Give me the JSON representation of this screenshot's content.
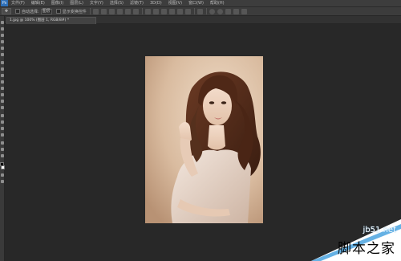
{
  "menubar": {
    "logo": "Ps",
    "items": [
      "文件(F)",
      "编辑(E)",
      "图像(I)",
      "图层(L)",
      "文字(Y)",
      "选择(S)",
      "滤镜(T)",
      "3D(D)",
      "视图(V)",
      "窗口(W)",
      "帮助(H)"
    ]
  },
  "options": {
    "auto_select_label": "自动选择:",
    "auto_select_value": "图层",
    "show_transform_label": "显示变换控件"
  },
  "document": {
    "tab_label": "1.jpg @ 100% (图层 1, RGB/8#) *"
  },
  "watermark": {
    "site": "jb51.net",
    "brand": "脚本之家"
  },
  "colors": {
    "accent": "#2e6fb8",
    "watermark_blue": "#4aa3df"
  }
}
